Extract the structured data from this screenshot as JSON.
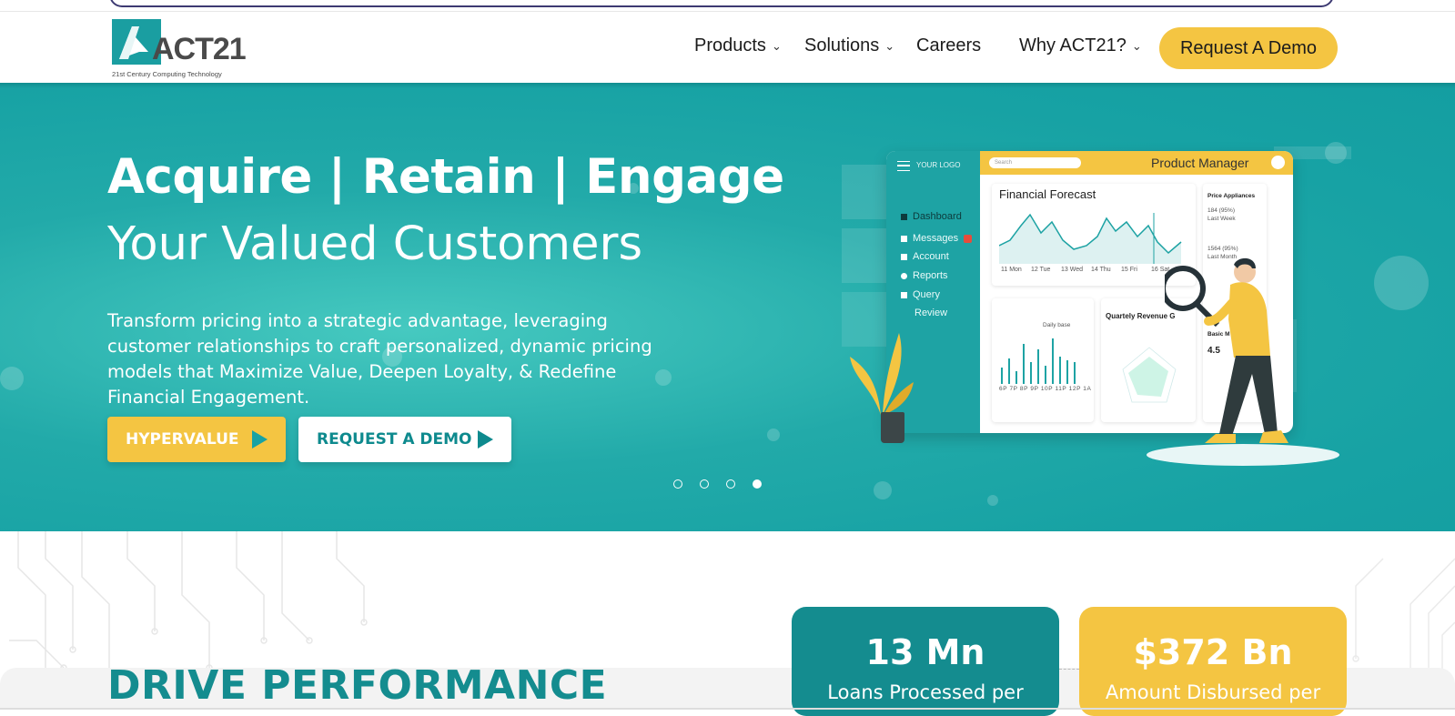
{
  "header": {
    "logo_text": "ACT21",
    "logo_tagline": "21st Century Computing Technology",
    "nav": [
      {
        "label": "Products",
        "has_dropdown": true
      },
      {
        "label": "Solutions",
        "has_dropdown": true
      },
      {
        "label": "Careers",
        "has_dropdown": false
      },
      {
        "label": "Why ACT21?",
        "has_dropdown": true
      }
    ],
    "cta_label": "Request A Demo"
  },
  "hero": {
    "title": "Acquire | Retain | Engage",
    "subtitle": "Your Valued Customers",
    "description": "Transform pricing into a strategic advantage, leveraging customer relationships to craft personalized, dynamic pricing models that Maximize Value, Deepen Loyalty, & Redefine Financial Engagement.",
    "primary_button": "HYPERVALUE",
    "secondary_button": "REQUEST A DEMO",
    "carousel": {
      "count": 4,
      "active": 4
    }
  },
  "dashboard_mock": {
    "logo": "YOUR LOGO",
    "search_placeholder": "Search",
    "role": "Product Manager",
    "menu": [
      "Dashboard",
      "Messages",
      "Account",
      "Reports",
      "Query",
      "Review"
    ],
    "forecast_title": "Financial Forecast",
    "forecast_days": [
      "11 Mon",
      "12 Tue",
      "13 Wed",
      "14 Thu",
      "15 Fri",
      "16 Sat"
    ],
    "price_title": "Price Appliances",
    "price_rows": [
      "184 (95%)",
      "Last Week",
      "1564 (95%)",
      "Last Month"
    ],
    "daily_title": "Daily base",
    "daily_labels": [
      "6P",
      "7P",
      "8P",
      "9P",
      "10P",
      "11P",
      "12P",
      "1A"
    ],
    "quarterly_title": "Quartely Revenue G",
    "basic_title": "Basic M",
    "basic_value": "4.5"
  },
  "stats": [
    {
      "value": "13 Mn",
      "label": "Loans Processed per"
    },
    {
      "value": "$372 Bn",
      "label": "Amount Disbursed per"
    }
  ],
  "section_title": "DRIVE PERFORMANCE",
  "colors": {
    "teal": "#17a2a4",
    "dark_teal": "#148c8f",
    "yellow": "#f4c542",
    "text_dark": "#1c1c1c"
  }
}
